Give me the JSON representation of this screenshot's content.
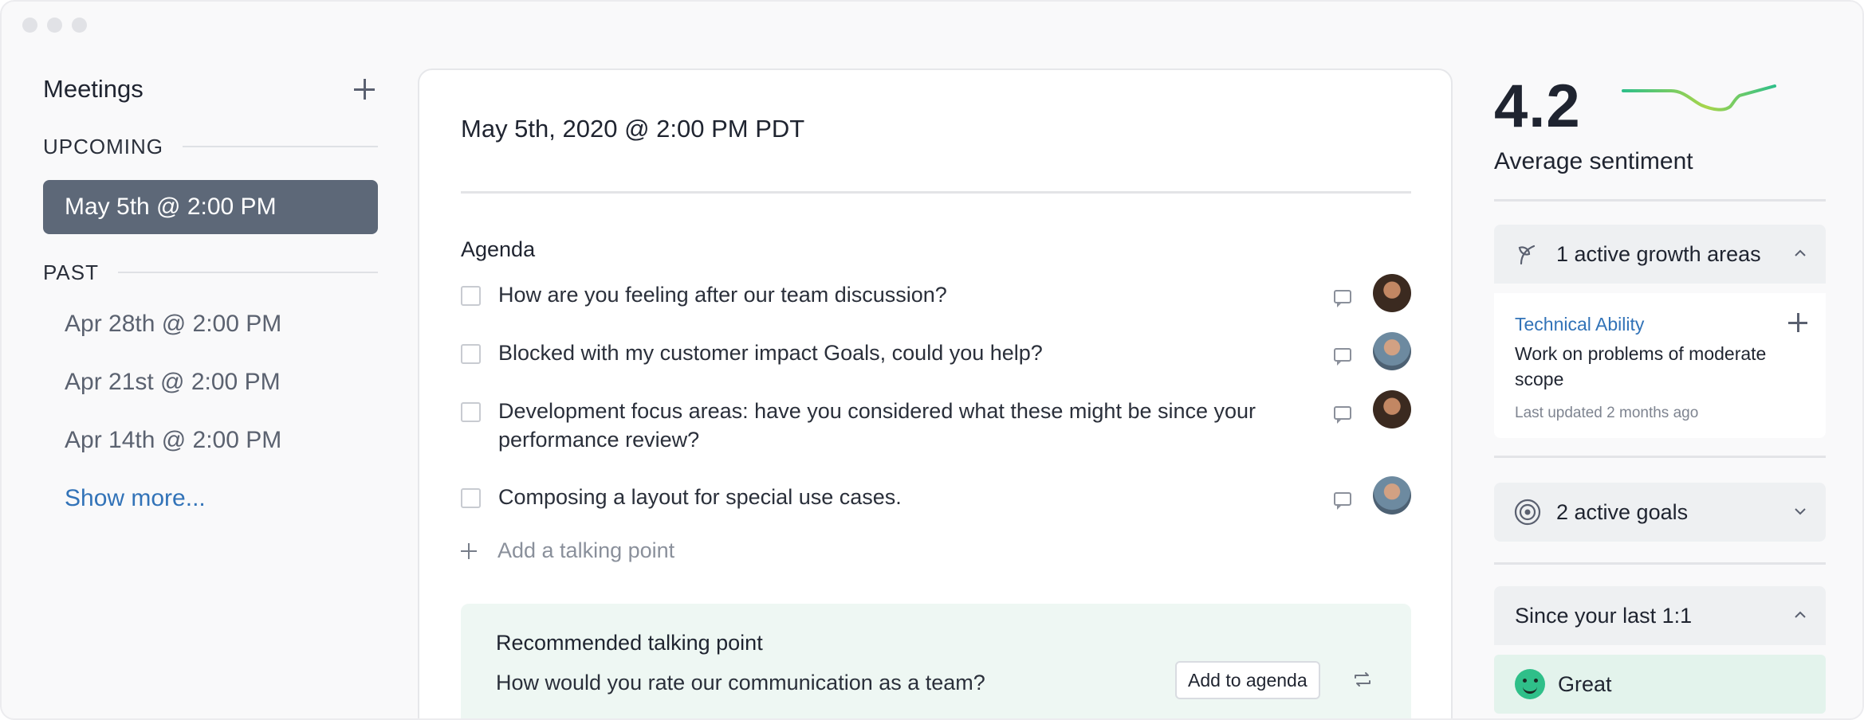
{
  "colors": {
    "accent_link": "#3273b8",
    "active_meeting_bg": "#5d6878",
    "recommended_bg": "#eef7f3",
    "sentiment_good": "#2fbf89"
  },
  "sidebar": {
    "title": "Meetings",
    "upcoming_label": "UPCOMING",
    "active_meeting": "May 5th @ 2:00 PM",
    "past_label": "PAST",
    "past_meetings": [
      "Apr 28th @ 2:00 PM",
      "Apr 21st @ 2:00 PM",
      "Apr 14th @ 2:00 PM"
    ],
    "show_more": "Show more..."
  },
  "main": {
    "title": "May 5th, 2020 @ 2:00 PM PDT",
    "agenda_label": "Agenda",
    "agenda_items": [
      {
        "text": "How are you feeling after our team discussion?",
        "avatar": "person-1"
      },
      {
        "text": "Blocked with my customer impact Goals, could you help?",
        "avatar": "person-2"
      },
      {
        "text": "Development focus areas: have you considered what these might be since your performance review?",
        "avatar": "person-1"
      },
      {
        "text": "Composing a layout for special use cases.",
        "avatar": "person-2"
      }
    ],
    "add_talking_point": "Add a talking point",
    "recommended": {
      "title": "Recommended talking point",
      "question": "How would you rate our communication as a team?",
      "button": "Add to agenda"
    }
  },
  "right": {
    "score": "4.2",
    "score_label": "Average sentiment",
    "growth_areas": {
      "label": "1 active growth areas",
      "icon": "growth-icon",
      "category": "Technical Ability",
      "description": "Work on problems of moderate scope",
      "updated": "Last updated 2 months ago"
    },
    "goals": {
      "label": "2 active goals",
      "icon": "target-icon"
    },
    "since_last": {
      "label": "Since your last 1:1",
      "rating": "Great"
    }
  }
}
